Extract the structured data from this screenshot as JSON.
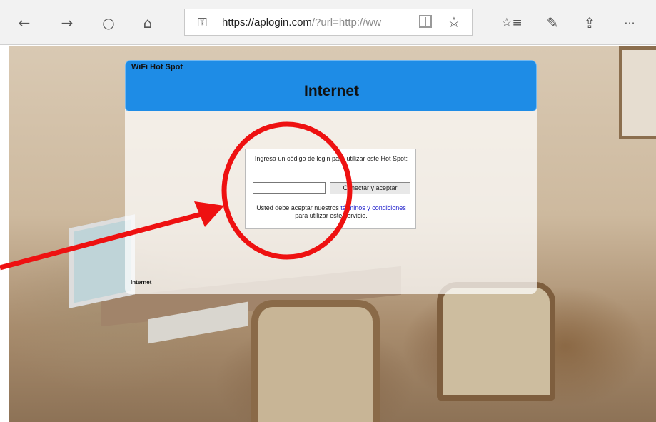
{
  "browser": {
    "back_glyph": "←",
    "forward_glyph": "→",
    "refresh_glyph": "○",
    "home_glyph": "⌂",
    "lock_glyph": "🔒",
    "url_host": "https://aplogin.com",
    "url_rest": "/?url=http://ww",
    "star_glyph": "☆",
    "favorites_glyph": "☆≡",
    "notes_glyph": "✎",
    "share_glyph": "⇪",
    "more_glyph": "···"
  },
  "panel": {
    "brand": "WiFi Hot Spot",
    "title": "Internet",
    "prompt": "Ingresa un código de login para utilizar este Hot Spot:",
    "code_value": "",
    "connect_label": "Conectar y aceptar",
    "terms_before": "Usted debe aceptar nuestros ",
    "terms_link": "términos y condiciones",
    "terms_after": " para utilizar este servicio.",
    "footer": "Internet"
  },
  "colors": {
    "header_blue": "#1e8ce6",
    "annotation_red": "#ee1111"
  },
  "icons": {
    "back": "back-arrow-icon",
    "forward": "forward-arrow-icon",
    "refresh": "refresh-icon",
    "home": "home-icon",
    "lock": "lock-icon",
    "reading_view": "reading-view-icon",
    "favorite": "star-icon",
    "favorites_list": "favorites-icon",
    "notes": "pen-icon",
    "share": "share-icon",
    "more": "more-icon"
  }
}
